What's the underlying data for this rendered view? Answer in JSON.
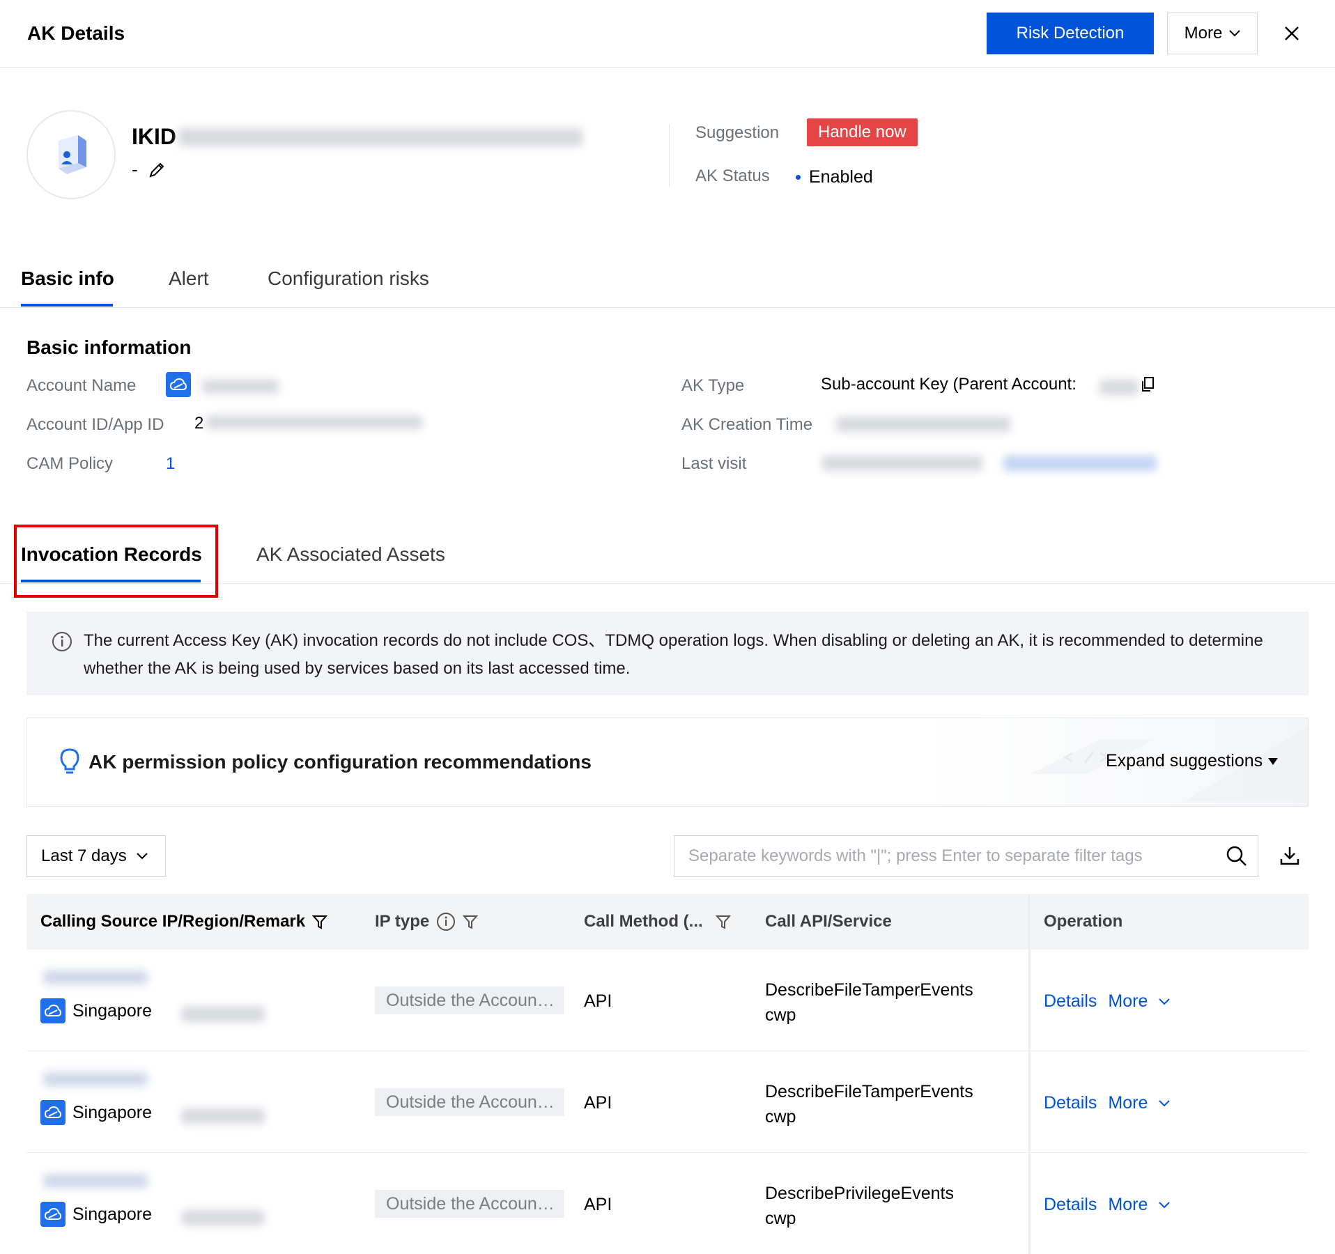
{
  "header": {
    "title": "AK Details",
    "risk_button": "Risk Detection",
    "more_button": "More"
  },
  "profile": {
    "ak_id_prefix": "IKID",
    "remark": "-",
    "suggestion_label": "Suggestion",
    "suggestion_value": "Handle now",
    "status_label": "AK Status",
    "status_value": "Enabled"
  },
  "top_tabs": [
    "Basic info",
    "Alert",
    "Configuration risks"
  ],
  "basic": {
    "section_title": "Basic information",
    "account_name_label": "Account Name",
    "account_id_label": "Account ID/App ID",
    "account_id_prefix": "2",
    "cam_policy_label": "CAM Policy",
    "cam_policy_value": "1",
    "ak_type_label": "AK Type",
    "ak_type_value": "Sub-account Key (Parent Account:",
    "creation_time_label": "AK Creation Time",
    "last_visit_label": "Last visit"
  },
  "sub_tabs": [
    "Invocation Records",
    "AK Associated Assets"
  ],
  "notice": {
    "text": "The current Access Key (AK) invocation records do not include COS、TDMQ operation logs. When disabling or deleting an AK, it is recommended to determine whether the AK is being used by services based on its last accessed time."
  },
  "suggestions": {
    "title": "AK permission policy configuration recommendations",
    "expand": "Expand suggestions"
  },
  "filters": {
    "time_range": "Last 7 days",
    "search_placeholder": "Separate keywords with \"|\"; press Enter to separate filter tags"
  },
  "table": {
    "columns": [
      "Calling Source IP/Region/Remark",
      "IP type",
      "Call Method (...",
      "Call API/Service",
      "Operation"
    ],
    "rows": [
      {
        "region": "Singapore",
        "ip_type": "Outside the Accoun…",
        "method": "API",
        "api": "DescribeFileTamperEvents",
        "service": "cwp",
        "details": "Details",
        "more": "More"
      },
      {
        "region": "Singapore",
        "ip_type": "Outside the Accoun…",
        "method": "API",
        "api": "DescribeFileTamperEvents",
        "service": "cwp",
        "details": "Details",
        "more": "More"
      },
      {
        "region": "Singapore",
        "ip_type": "Outside the Accoun…",
        "method": "API",
        "api": "DescribePrivilegeEvents",
        "service": "cwp",
        "details": "Details",
        "more": "More"
      }
    ]
  },
  "colors": {
    "primary": "#0052d9",
    "danger": "#e54545",
    "highlight_border": "#e60000"
  }
}
